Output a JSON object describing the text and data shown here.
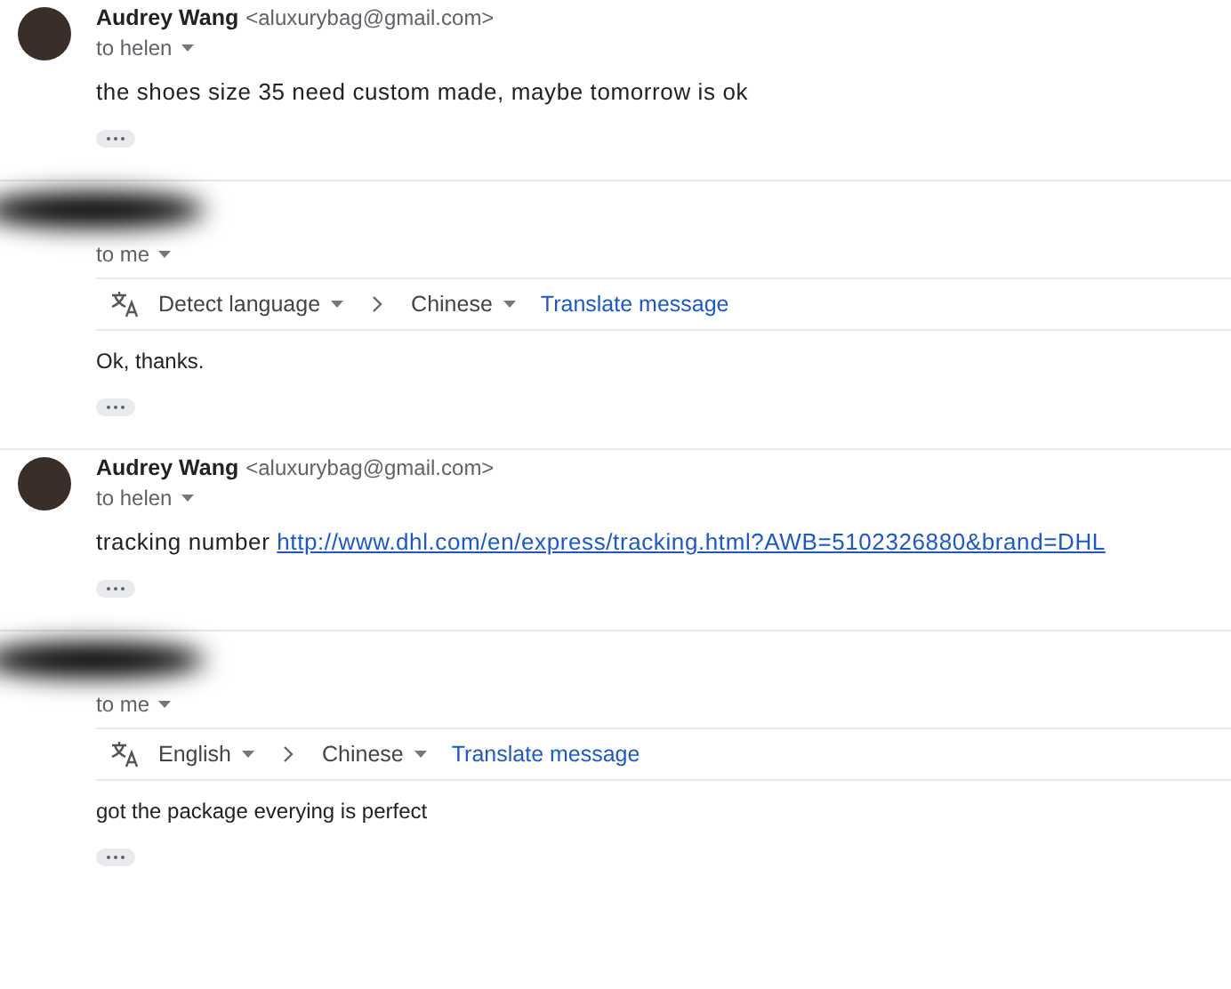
{
  "messages": [
    {
      "redacted": false,
      "sender": {
        "name": "Audrey Wang",
        "email": "<aluxurybag@gmail.com>"
      },
      "recipient": "to helen",
      "body": "the shoes size 35 need custom made, maybe tomorrow is ok"
    },
    {
      "redacted": true,
      "recipient": "to me",
      "translate": {
        "source": "Detect language",
        "target": "Chinese",
        "action": "Translate message"
      },
      "body": "Ok, thanks."
    },
    {
      "redacted": false,
      "sender": {
        "name": "Audrey Wang",
        "email": "<aluxurybag@gmail.com>"
      },
      "recipient": "to helen",
      "body": "tracking number",
      "link": "http://www.dhl.com/en/express/tracking.html?AWB=5102326880&brand=DHL"
    },
    {
      "redacted": true,
      "recipient": "to me",
      "translate": {
        "source": "English",
        "target": "Chinese",
        "action": "Translate message"
      },
      "body": "got the package everying is perfect"
    }
  ]
}
